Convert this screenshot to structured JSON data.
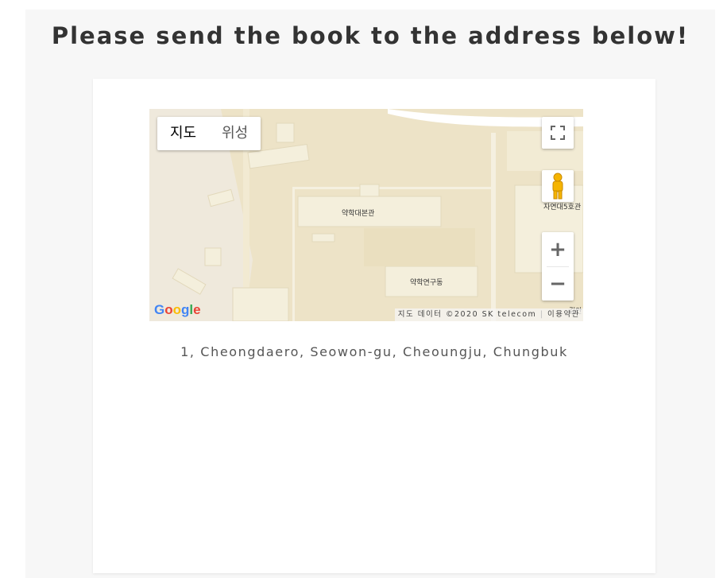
{
  "heading": "Please send the book to the address below!",
  "map": {
    "type_buttons": [
      "지도",
      "위성"
    ],
    "active_type": "지도",
    "labels": {
      "main_building": "약학대본관",
      "research_building": "약학연구동",
      "right_building": "자연대5호관",
      "edge_label": "길안"
    },
    "logo": "Google",
    "attribution": "지도 데이터 ©2020 SK telecom",
    "terms": "이용약관",
    "zoom_in": "+",
    "zoom_out": "−",
    "colors": {
      "land": "#ede3c7",
      "building": "#f4efdc",
      "road": "#ffffff"
    }
  },
  "address": "1, Cheongdaero, Seowon-gu, Cheoungju, Chungbuk"
}
